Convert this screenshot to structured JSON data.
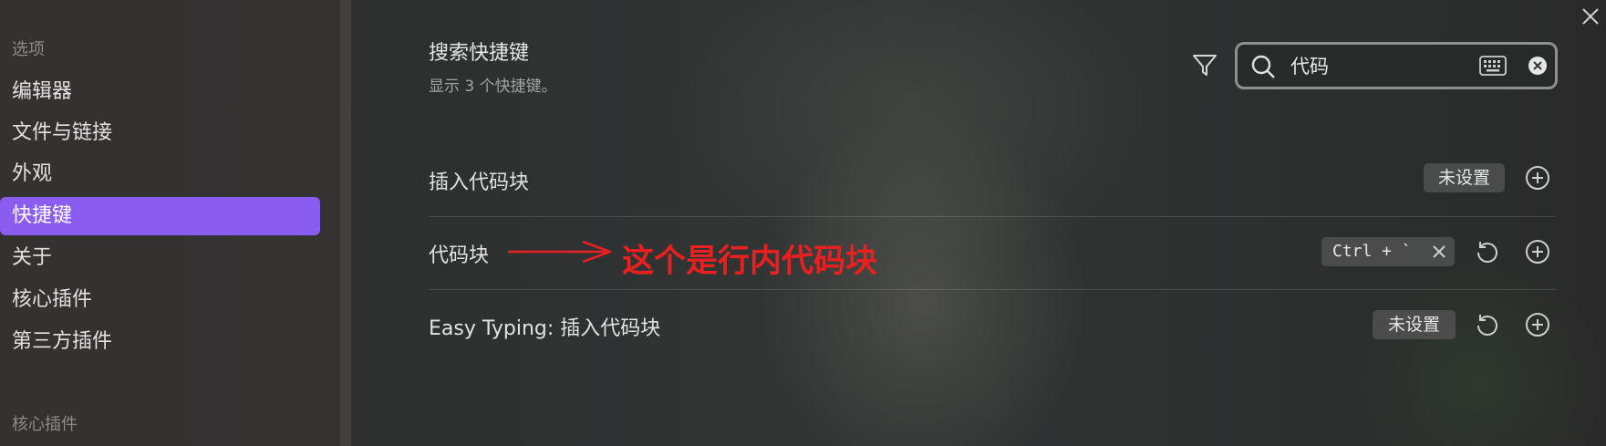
{
  "sidebar": {
    "heading": "选项",
    "items": [
      {
        "label": "编辑器"
      },
      {
        "label": "文件与链接"
      },
      {
        "label": "外观"
      },
      {
        "label": "快捷键"
      },
      {
        "label": "关于"
      },
      {
        "label": "核心插件"
      },
      {
        "label": "第三方插件"
      }
    ],
    "section_heading": "核心插件"
  },
  "main": {
    "title": "搜索快捷键",
    "subtitle": "显示 3 个快捷键。",
    "search": {
      "value": "代码"
    },
    "rows": [
      {
        "label": "插入代码块",
        "hotkey_tag": "未设置"
      },
      {
        "label": "代码块",
        "hotkey_tag": "Ctrl + `"
      },
      {
        "label": "Easy Typing: 插入代码块",
        "hotkey_tag": "未设置"
      }
    ],
    "annotation": "这个是行内代码块"
  },
  "colors": {
    "accent": "#8a5cf0",
    "annotation": "#e82020"
  },
  "icons": [
    "filter-icon",
    "search-icon",
    "keyboard-icon",
    "clear-icon",
    "close-icon",
    "reset-icon",
    "add-icon",
    "remove-icon"
  ]
}
